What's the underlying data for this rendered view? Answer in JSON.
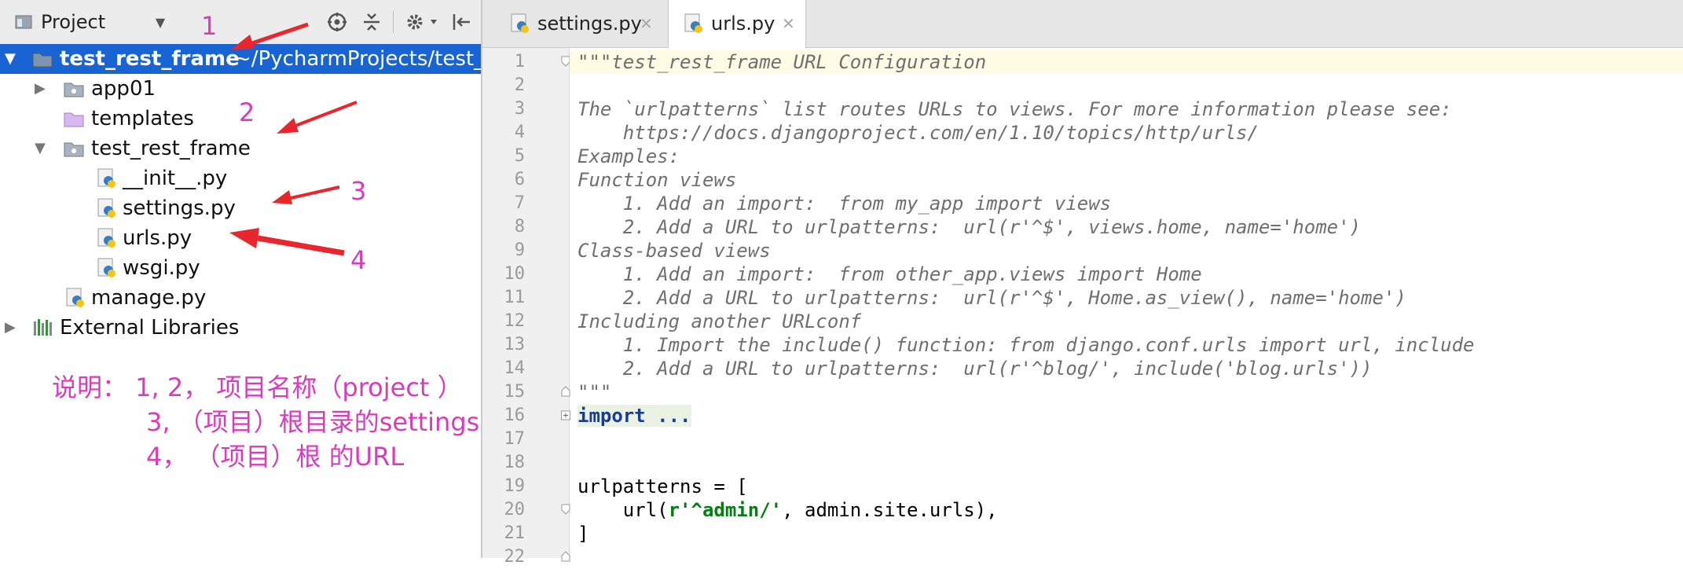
{
  "project_panel": {
    "view_label": "Project",
    "tree": [
      {
        "name": "test_rest_frame",
        "path": "~/PycharmProjects/test_",
        "depth": 0,
        "expanded": true,
        "type": "project-folder",
        "selected": true
      },
      {
        "name": "app01",
        "depth": 1,
        "expanded": false,
        "type": "package-folder"
      },
      {
        "name": "templates",
        "depth": 1,
        "type": "templates-folder"
      },
      {
        "name": "test_rest_frame",
        "depth": 1,
        "expanded": true,
        "type": "package-folder"
      },
      {
        "name": "__init__.py",
        "depth": 2,
        "type": "python-file"
      },
      {
        "name": "settings.py",
        "depth": 2,
        "type": "python-file"
      },
      {
        "name": "urls.py",
        "depth": 2,
        "type": "python-file"
      },
      {
        "name": "wsgi.py",
        "depth": 2,
        "type": "python-file"
      },
      {
        "name": "manage.py",
        "depth": 1,
        "type": "python-file"
      },
      {
        "name": "External Libraries",
        "depth": 0,
        "expanded": false,
        "type": "library"
      }
    ]
  },
  "annotations": {
    "numbers": [
      "1",
      "2",
      "3",
      "4"
    ],
    "explanation": [
      "说明：  1, 2，  项目名称（project ）",
      "3, （项目）根目录的settings",
      "4， （项目）根 的URL"
    ],
    "color": "#d73dbb"
  },
  "editor": {
    "tabs": [
      {
        "label": "settings.py",
        "active": false
      },
      {
        "label": "urls.py",
        "active": true
      }
    ],
    "line_numbers": [
      "1",
      "2",
      "3",
      "4",
      "5",
      "6",
      "7",
      "8",
      "9",
      "10",
      "11",
      "12",
      "13",
      "14",
      "15",
      "16",
      "17",
      "18",
      "19",
      "20",
      "21",
      "22"
    ],
    "code": {
      "l1": "\"\"\"test_rest_frame URL Configuration",
      "l3": "The `urlpatterns` list routes URLs to views. For more information please see:",
      "l4": "    https://docs.djangoproject.com/en/1.10/topics/http/urls/",
      "l5": "Examples:",
      "l6": "Function views",
      "l7": "    1. Add an import:  from my_app import views",
      "l8": "    2. Add a URL to urlpatterns:  url(r'^$', views.home, name='home')",
      "l9": "Class-based views",
      "l10": "    1. Add an import:  from other_app.views import Home",
      "l11": "    2. Add a URL to urlpatterns:  url(r'^$', Home.as_view(), name='home')",
      "l12": "Including another URLconf",
      "l13": "    1. Import the include() function: from django.conf.urls import url, include",
      "l14": "    2. Add a URL to urlpatterns:  url(r'^blog/', include('blog.urls'))",
      "l15": "\"\"\"",
      "l16": "import ...",
      "l19": "urlpatterns = [",
      "l20_pre": "    url(",
      "l20_str": "r'^admin/'",
      "l20_post": ", admin.site.urls),",
      "l21": "]"
    }
  },
  "colors": {
    "selection": "#1864d3",
    "annotation": "#d73dbb",
    "arrow": "#e8262e"
  }
}
